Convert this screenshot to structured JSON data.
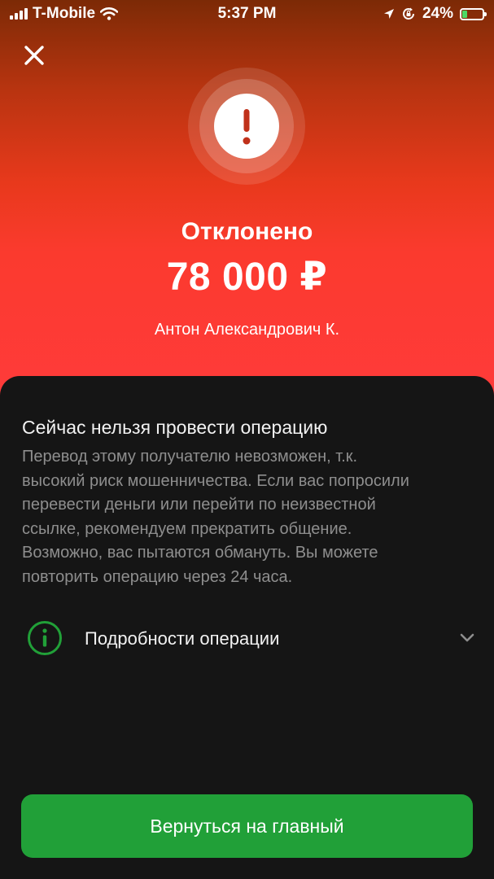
{
  "status_bar": {
    "carrier": "T-Mobile",
    "time": "5:37 PM",
    "battery_percent": "24%",
    "battery_level": 0.24,
    "icons": [
      "signal-icon",
      "wifi-icon",
      "location-icon",
      "rotation-lock-icon",
      "battery-icon"
    ]
  },
  "hero": {
    "status_title": "Отклонено",
    "amount": "78 000 ₽",
    "recipient": "Антон Александрович К.",
    "icon": "alert-icon",
    "gradient_colors": [
      "#7c2a06",
      "#e8391c",
      "#ff3b3b"
    ]
  },
  "sheet": {
    "title": "Сейчас нельзя провести операцию",
    "lines": [
      "Перевод этому получателю невозможен, т.к.",
      "высокий риск мошенничества. Если вас попросили",
      "перевести деньги или перейти по неизвестной",
      "ссылке, рекомендуем прекратить общение.",
      "Возможно, вас пытаются обмануть. Вы можете",
      "повторить операцию через 24 часа."
    ],
    "details_label": "Подробности операции",
    "details_icon": "info-icon",
    "accent_color": "#21a038"
  },
  "actions": {
    "primary_label": "Вернуться на главный"
  }
}
